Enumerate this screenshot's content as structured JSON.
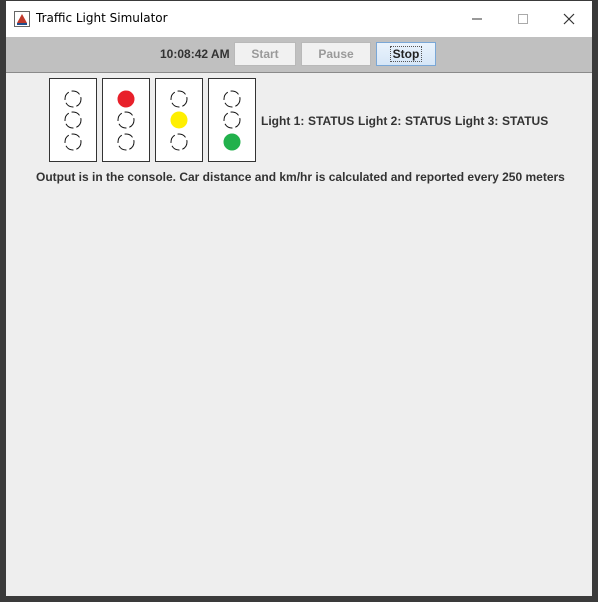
{
  "window": {
    "title": "Traffic Light Simulator"
  },
  "toolbar": {
    "clock": "10:08:42 AM",
    "start_label": "Start",
    "pause_label": "Pause",
    "stop_label": "Stop"
  },
  "lights": [
    {
      "state": "off"
    },
    {
      "state": "red"
    },
    {
      "state": "yellow"
    },
    {
      "state": "green"
    }
  ],
  "status": {
    "light1_label": "Light 1:",
    "light1_value": "STATUS",
    "light2_label": "Light 2:",
    "light2_value": "STATUS",
    "light3_label": "Light 3:",
    "light3_value": "STATUS"
  },
  "message": "Output is in the console. Car distance and km/hr is calculated and reported every 250 meters",
  "colors": {
    "red": "#e8202a",
    "yellow": "#ffef00",
    "green": "#22b14c",
    "toolbar": "#c0c0c0",
    "content": "#eeeeee"
  }
}
